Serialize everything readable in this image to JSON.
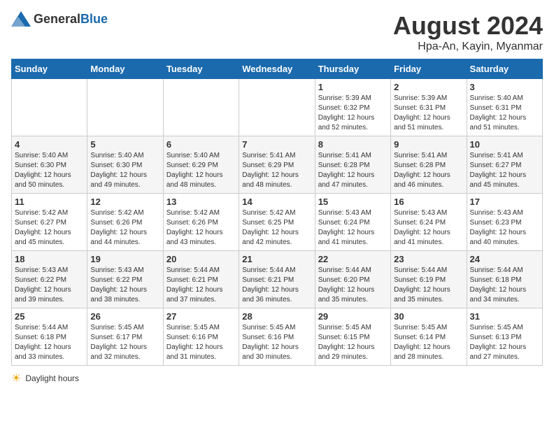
{
  "header": {
    "logo_general": "General",
    "logo_blue": "Blue",
    "title": "August 2024",
    "subtitle": "Hpa-An, Kayin, Myanmar"
  },
  "days_of_week": [
    "Sunday",
    "Monday",
    "Tuesday",
    "Wednesday",
    "Thursday",
    "Friday",
    "Saturday"
  ],
  "weeks": [
    [
      {
        "day": "",
        "sunrise": "",
        "sunset": "",
        "daylight": ""
      },
      {
        "day": "",
        "sunrise": "",
        "sunset": "",
        "daylight": ""
      },
      {
        "day": "",
        "sunrise": "",
        "sunset": "",
        "daylight": ""
      },
      {
        "day": "",
        "sunrise": "",
        "sunset": "",
        "daylight": ""
      },
      {
        "day": "1",
        "sunrise": "5:39 AM",
        "sunset": "6:32 PM",
        "daylight": "12 hours and 52 minutes."
      },
      {
        "day": "2",
        "sunrise": "5:39 AM",
        "sunset": "6:31 PM",
        "daylight": "12 hours and 51 minutes."
      },
      {
        "day": "3",
        "sunrise": "5:40 AM",
        "sunset": "6:31 PM",
        "daylight": "12 hours and 51 minutes."
      }
    ],
    [
      {
        "day": "4",
        "sunrise": "5:40 AM",
        "sunset": "6:30 PM",
        "daylight": "12 hours and 50 minutes."
      },
      {
        "day": "5",
        "sunrise": "5:40 AM",
        "sunset": "6:30 PM",
        "daylight": "12 hours and 49 minutes."
      },
      {
        "day": "6",
        "sunrise": "5:40 AM",
        "sunset": "6:29 PM",
        "daylight": "12 hours and 48 minutes."
      },
      {
        "day": "7",
        "sunrise": "5:41 AM",
        "sunset": "6:29 PM",
        "daylight": "12 hours and 48 minutes."
      },
      {
        "day": "8",
        "sunrise": "5:41 AM",
        "sunset": "6:28 PM",
        "daylight": "12 hours and 47 minutes."
      },
      {
        "day": "9",
        "sunrise": "5:41 AM",
        "sunset": "6:28 PM",
        "daylight": "12 hours and 46 minutes."
      },
      {
        "day": "10",
        "sunrise": "5:41 AM",
        "sunset": "6:27 PM",
        "daylight": "12 hours and 45 minutes."
      }
    ],
    [
      {
        "day": "11",
        "sunrise": "5:42 AM",
        "sunset": "6:27 PM",
        "daylight": "12 hours and 45 minutes."
      },
      {
        "day": "12",
        "sunrise": "5:42 AM",
        "sunset": "6:26 PM",
        "daylight": "12 hours and 44 minutes."
      },
      {
        "day": "13",
        "sunrise": "5:42 AM",
        "sunset": "6:26 PM",
        "daylight": "12 hours and 43 minutes."
      },
      {
        "day": "14",
        "sunrise": "5:42 AM",
        "sunset": "6:25 PM",
        "daylight": "12 hours and 42 minutes."
      },
      {
        "day": "15",
        "sunrise": "5:43 AM",
        "sunset": "6:24 PM",
        "daylight": "12 hours and 41 minutes."
      },
      {
        "day": "16",
        "sunrise": "5:43 AM",
        "sunset": "6:24 PM",
        "daylight": "12 hours and 41 minutes."
      },
      {
        "day": "17",
        "sunrise": "5:43 AM",
        "sunset": "6:23 PM",
        "daylight": "12 hours and 40 minutes."
      }
    ],
    [
      {
        "day": "18",
        "sunrise": "5:43 AM",
        "sunset": "6:22 PM",
        "daylight": "12 hours and 39 minutes."
      },
      {
        "day": "19",
        "sunrise": "5:43 AM",
        "sunset": "6:22 PM",
        "daylight": "12 hours and 38 minutes."
      },
      {
        "day": "20",
        "sunrise": "5:44 AM",
        "sunset": "6:21 PM",
        "daylight": "12 hours and 37 minutes."
      },
      {
        "day": "21",
        "sunrise": "5:44 AM",
        "sunset": "6:21 PM",
        "daylight": "12 hours and 36 minutes."
      },
      {
        "day": "22",
        "sunrise": "5:44 AM",
        "sunset": "6:20 PM",
        "daylight": "12 hours and 35 minutes."
      },
      {
        "day": "23",
        "sunrise": "5:44 AM",
        "sunset": "6:19 PM",
        "daylight": "12 hours and 35 minutes."
      },
      {
        "day": "24",
        "sunrise": "5:44 AM",
        "sunset": "6:18 PM",
        "daylight": "12 hours and 34 minutes."
      }
    ],
    [
      {
        "day": "25",
        "sunrise": "5:44 AM",
        "sunset": "6:18 PM",
        "daylight": "12 hours and 33 minutes."
      },
      {
        "day": "26",
        "sunrise": "5:45 AM",
        "sunset": "6:17 PM",
        "daylight": "12 hours and 32 minutes."
      },
      {
        "day": "27",
        "sunrise": "5:45 AM",
        "sunset": "6:16 PM",
        "daylight": "12 hours and 31 minutes."
      },
      {
        "day": "28",
        "sunrise": "5:45 AM",
        "sunset": "6:16 PM",
        "daylight": "12 hours and 30 minutes."
      },
      {
        "day": "29",
        "sunrise": "5:45 AM",
        "sunset": "6:15 PM",
        "daylight": "12 hours and 29 minutes."
      },
      {
        "day": "30",
        "sunrise": "5:45 AM",
        "sunset": "6:14 PM",
        "daylight": "12 hours and 28 minutes."
      },
      {
        "day": "31",
        "sunrise": "5:45 AM",
        "sunset": "6:13 PM",
        "daylight": "12 hours and 27 minutes."
      }
    ]
  ],
  "footer": {
    "label": "Daylight hours"
  }
}
